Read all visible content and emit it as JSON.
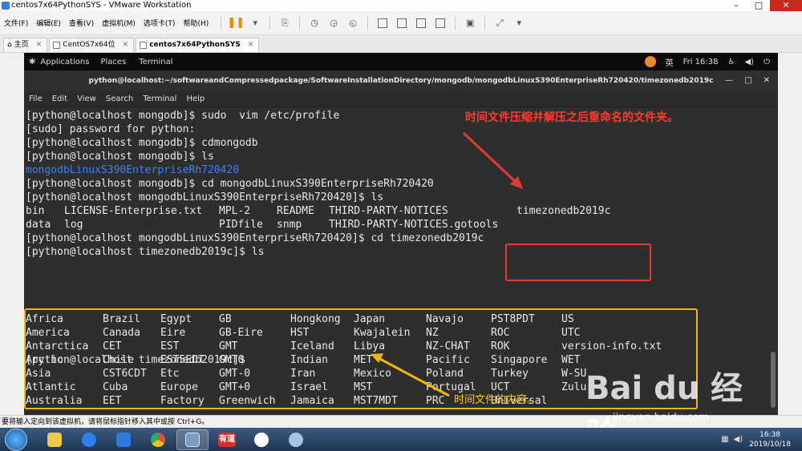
{
  "vmware": {
    "title": "centos7x64PythonSYS - VMware Workstation",
    "menu": [
      "文件(F)",
      "编辑(E)",
      "查看(V)",
      "虚拟机(M)",
      "选项卡(T)",
      "帮助(H)"
    ],
    "tabs": [
      {
        "label": "主页"
      },
      {
        "label": "CentOS7x64位"
      },
      {
        "label": "centos7x64PythonSYS"
      }
    ],
    "status_text": "要将输入定向到该虚拟机，请将鼠标指针移入其中或按 Ctrl+G。"
  },
  "gnome": {
    "applications": "Applications",
    "places": "Places",
    "terminal": "Terminal",
    "input_method": "英",
    "clock": "Fri 16:38"
  },
  "terminal": {
    "title": "python@localhost:~/softwareandCompressedpackage/SoftwareInstallationDirectory/mongodb/mongodbLinuxS390EnterpriseRh720420/timezonedb2019c",
    "menu": [
      "File",
      "Edit",
      "View",
      "Search",
      "Terminal",
      "Help"
    ],
    "lines": [
      "[python@localhost mongodb]$ sudo  vim /etc/profile",
      "[sudo] password for python:",
      "[python@localhost mongodb]$ cdmongodb",
      "[python@localhost mongodb]$ ls",
      "mongodbLinuxS390EnterpriseRh720420",
      "[python@localhost mongodb]$ cd mongodbLinuxS390EnterpriseRh720420",
      "[python@localhost mongodbLinuxS390EnterpriseRh720420]$ ls"
    ],
    "ls1_row1": [
      "bin",
      "LICENSE-Enterprise.txt",
      "MPL-2",
      "README",
      "THIRD-PARTY-NOTICES",
      "timezonedb2019c"
    ],
    "ls1_row2": [
      "data",
      "log",
      "PIDfile",
      "snmp",
      "THIRD-PARTY-NOTICES.gotools"
    ],
    "cd_line": "[python@localhost mongodbLinuxS390EnterpriseRh720420]$ cd timezonedb2019c",
    "ls2_cmd": "[python@localhost timezonedb2019c]$ ls",
    "grid": [
      [
        "Africa",
        "Brazil",
        "Egypt",
        "GB",
        "Hongkong",
        "Japan",
        "Navajo",
        "PST8PDT",
        "US"
      ],
      [
        "America",
        "Canada",
        "Eire",
        "GB-Eire",
        "HST",
        "Kwajalein",
        "NZ",
        "ROC",
        "UTC"
      ],
      [
        "Antarctica",
        "CET",
        "EST",
        "GMT",
        "Iceland",
        "Libya",
        "NZ-CHAT",
        "ROK",
        "version-info.txt"
      ],
      [
        "Arctic",
        "Chile",
        "EST5EDT",
        "GMT0",
        "Indian",
        "MET",
        "Pacific",
        "Singapore",
        "WET"
      ],
      [
        "Asia",
        "CST6CDT",
        "Etc",
        "GMT-0",
        "Iran",
        "Mexico",
        "Poland",
        "Turkey",
        "W-SU"
      ],
      [
        "Atlantic",
        "Cuba",
        "Europe",
        "GMT+0",
        "Israel",
        "MST",
        "Portugal",
        "UCT",
        "Zulu"
      ],
      [
        "Australia",
        "EET",
        "Factory",
        "Greenwich",
        "Jamaica",
        "MST7MDT",
        "PRC",
        "Universal",
        ""
      ]
    ],
    "final_prompt": "[python@localhost timezonedb2019c]$"
  },
  "annotations": {
    "red_text": "时间文件压缩并解压之后重命名的文件夹。",
    "yellow_text": "时间文件的内容。",
    "red_color": "#e53935",
    "yellow_color": "#f2b705"
  },
  "colors": {
    "dir_blue": "#3b82f6",
    "terminal_bg": "#2e2e2e"
  },
  "taskbar": {
    "youdao_label": "有道",
    "clock_time": "16:38",
    "clock_date": "2019/10/18"
  },
  "watermark": {
    "logo": "Bai du 经验",
    "sub": "jingyan.baidu.com"
  }
}
